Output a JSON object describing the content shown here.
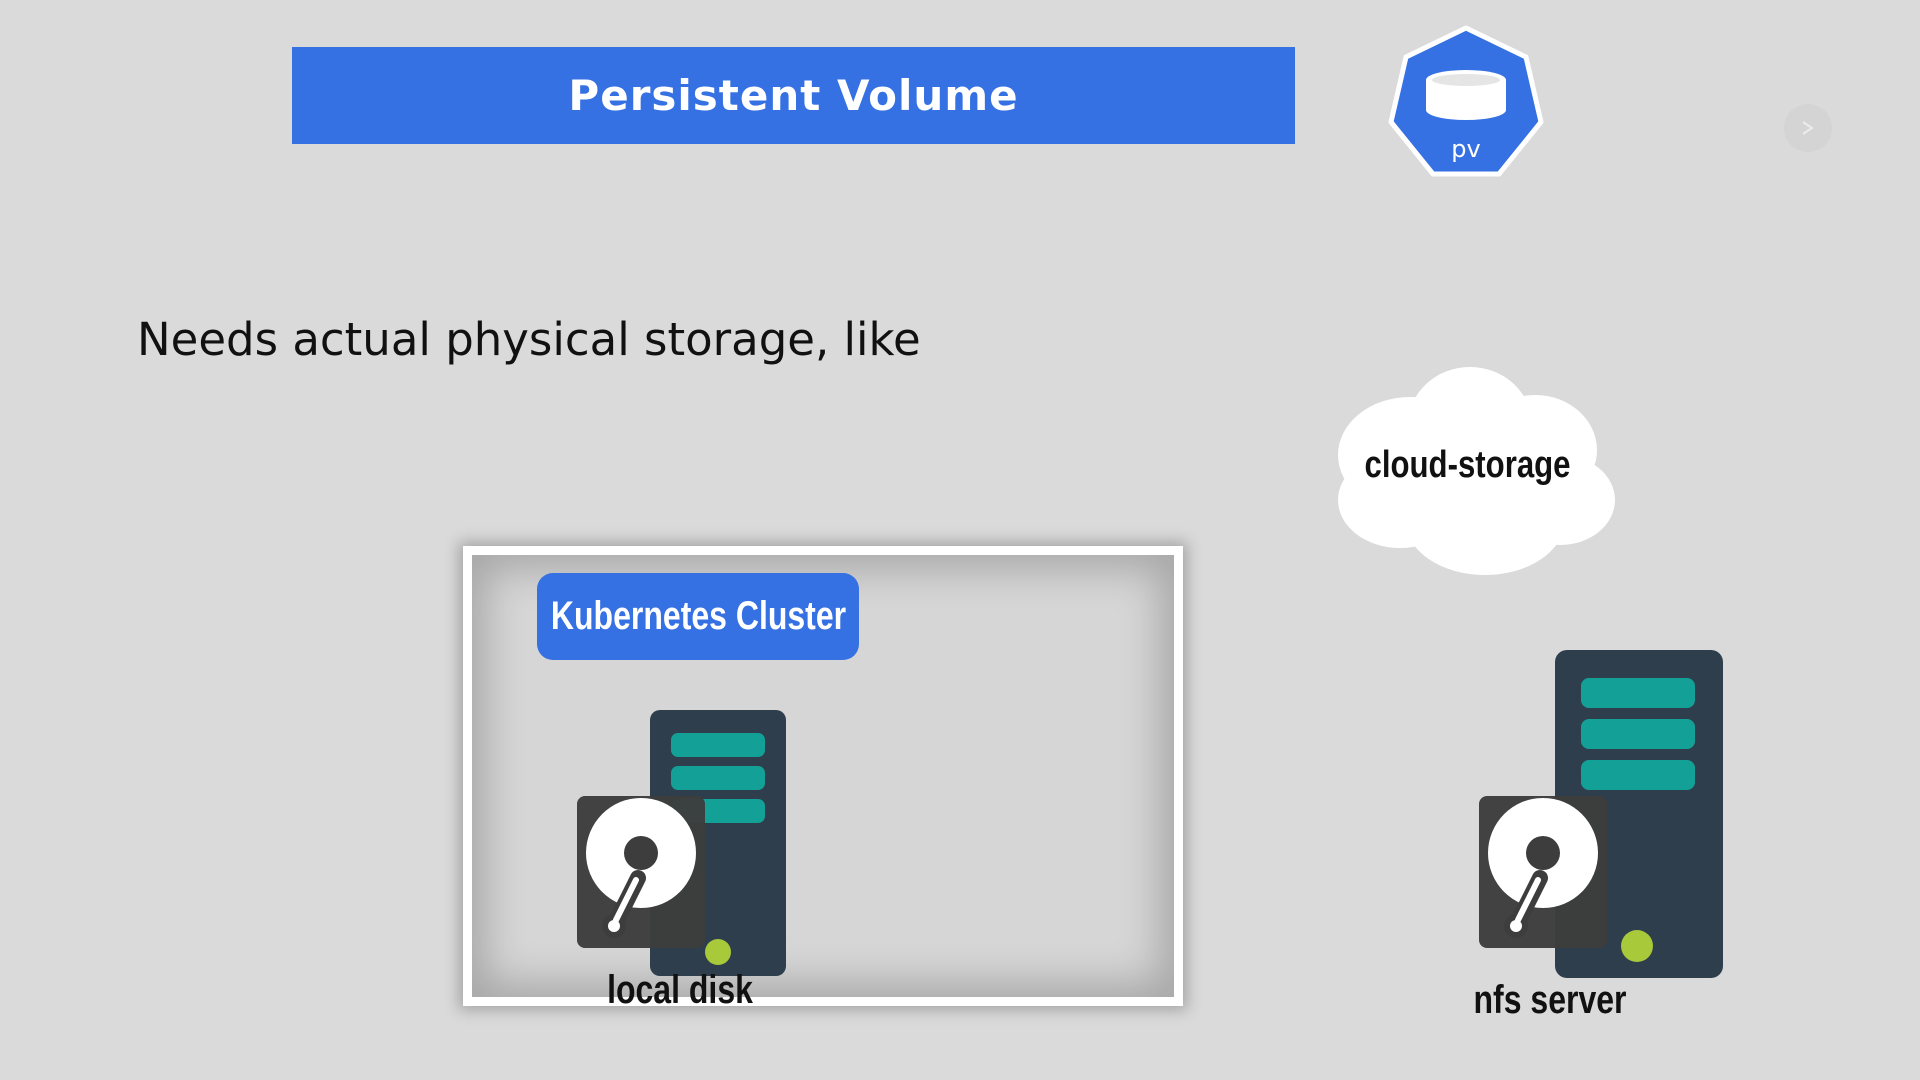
{
  "title": "Persistent Volume",
  "logo": {
    "label": "pv",
    "color": "#3571e3",
    "icon": "database-icon"
  },
  "subtitle": "Needs actual physical storage, like",
  "storage_options": {
    "cloud": {
      "label": "cloud-storage",
      "icon": "cloud-icon"
    },
    "cluster": {
      "label": "Kubernetes Cluster"
    },
    "local": {
      "label": "local disk",
      "icon": "server-hdd-icon"
    },
    "nfs": {
      "label": "nfs server",
      "icon": "server-hdd-icon"
    }
  },
  "colors": {
    "accent": "#3571e3",
    "background": "#dadada",
    "server_body": "#2e3e4d",
    "server_slot": "#13a197",
    "status_led": "#a8c93a",
    "disk_body": "#3d3d3d"
  }
}
